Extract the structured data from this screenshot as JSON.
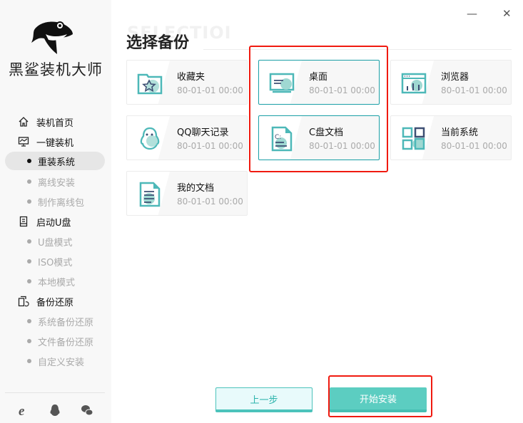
{
  "app": {
    "brand": "黑鲨装机大师"
  },
  "window": {
    "minimize": "—",
    "close": "✕"
  },
  "sidebar": {
    "items": [
      {
        "label": "装机首页",
        "type": "group",
        "icon": "home-icon"
      },
      {
        "label": "一键装机",
        "type": "group",
        "icon": "monitor-icon"
      },
      {
        "label": "重装系统",
        "type": "sub",
        "selected": true
      },
      {
        "label": "离线安装",
        "type": "sub"
      },
      {
        "label": "制作离线包",
        "type": "sub"
      },
      {
        "label": "启动U盘",
        "type": "group",
        "icon": "usb-icon"
      },
      {
        "label": "U盘模式",
        "type": "sub"
      },
      {
        "label": "ISO模式",
        "type": "sub"
      },
      {
        "label": "本地模式",
        "type": "sub"
      },
      {
        "label": "备份还原",
        "type": "group",
        "icon": "backup-restore-icon"
      },
      {
        "label": "系统备份还原",
        "type": "sub"
      },
      {
        "label": "文件备份还原",
        "type": "sub"
      },
      {
        "label": "自定义安装",
        "type": "sub"
      }
    ],
    "footer_icons": [
      "ie-browser-icon",
      "qq-icon",
      "wechat-icon"
    ]
  },
  "main": {
    "watermark": "SELECTIOI",
    "title": "选择备份",
    "cards": [
      {
        "name": "收藏夹",
        "time": "80-01-01 00:00",
        "icon": "favorites-folder-icon",
        "selected": false
      },
      {
        "name": "桌面",
        "time": "80-01-01 00:00",
        "icon": "desktop-icon",
        "selected": true
      },
      {
        "name": "浏览器",
        "time": "80-01-01 00:00",
        "icon": "browser-icon",
        "selected": false
      },
      {
        "name": "QQ聊天记录",
        "time": "80-01-01 00:00",
        "icon": "qq-icon",
        "selected": false
      },
      {
        "name": "C盘文档",
        "time": "80-01-01 00:00",
        "icon": "c-drive-document-icon",
        "selected": true
      },
      {
        "name": "当前系统",
        "time": "80-01-01 00:00",
        "icon": "system-grid-icon",
        "selected": false
      },
      {
        "name": "我的文档",
        "time": "80-01-01 00:00",
        "icon": "document-icon",
        "selected": false
      }
    ],
    "prev_label": "上一步",
    "start_label": "开始安装"
  },
  "colors": {
    "accent": "#5ccdc1",
    "selected_border": "#1a9fa6",
    "highlight": "#f01a10"
  }
}
